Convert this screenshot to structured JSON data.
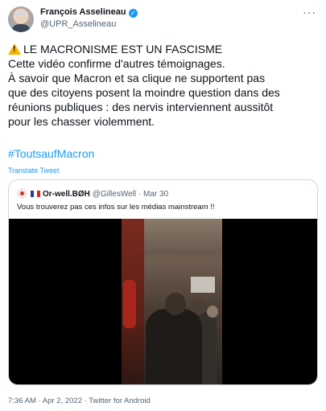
{
  "author": {
    "name": "François Asselineau",
    "handle": "@UPR_Asselineau",
    "verified_icon": "check-icon"
  },
  "tweet": {
    "lines": [
      "LE MACRONISME EST UN FASCISME",
      "Cette vidéo confirme d'autres témoignages.",
      "À savoir que Macron et sa clique ne supportent pas",
      "que des citoyens posent la moindre question dans des",
      "réunions publiques : des nervis interviennent aussitôt",
      "pour les chasser violemment."
    ],
    "warning_icon": "warning-icon",
    "hashtag": "#ToutsaufMacron",
    "translate_label": "Translate Tweet"
  },
  "quote": {
    "name": "Or-well.BØH",
    "handle": "@GillesWell",
    "separator": "·",
    "date": "Mar 30",
    "text": "Vous trouverez pas ces infos sur les médias mainstream !!"
  },
  "footer": {
    "time": "7:36 AM",
    "date": "Apr 2, 2022",
    "source": "Twitter for Android",
    "separator": "·"
  },
  "colors": {
    "accent": "#1d9bf0",
    "text": "#0f1419",
    "muted": "#536471",
    "border": "#cfd9de"
  }
}
